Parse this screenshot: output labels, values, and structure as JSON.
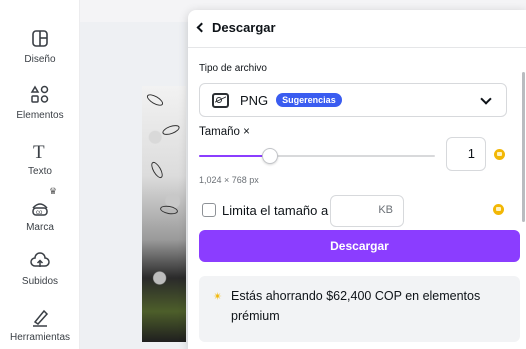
{
  "sidebar": {
    "items": [
      {
        "label": "Diseño",
        "icon": "layout-icon"
      },
      {
        "label": "Elementos",
        "icon": "shapes-icon"
      },
      {
        "label": "Texto",
        "icon": "text-icon"
      },
      {
        "label": "Marca",
        "icon": "brand-icon"
      },
      {
        "label": "Subidos",
        "icon": "upload-cloud-icon"
      },
      {
        "label": "Herramientas",
        "icon": "pen-icon"
      }
    ]
  },
  "panel": {
    "title": "Descargar",
    "file_type_label": "Tipo de archivo",
    "file_type_value": "PNG",
    "suggestions_badge": "Sugerencias",
    "size_label": "Tamaño ×",
    "size_value": "1",
    "size_fraction": 0.3,
    "dimensions": "1,024 × 768 px",
    "limit_label": "Limita el tamaño a",
    "kb_unit": "KB",
    "download_button": "Descargar",
    "promo_text": "Estás ahorrando $62,400 COP en elementos prémium"
  },
  "colors": {
    "accent": "#8b3dff",
    "badge": "#3a5cf0",
    "premium": "#f2b705"
  }
}
